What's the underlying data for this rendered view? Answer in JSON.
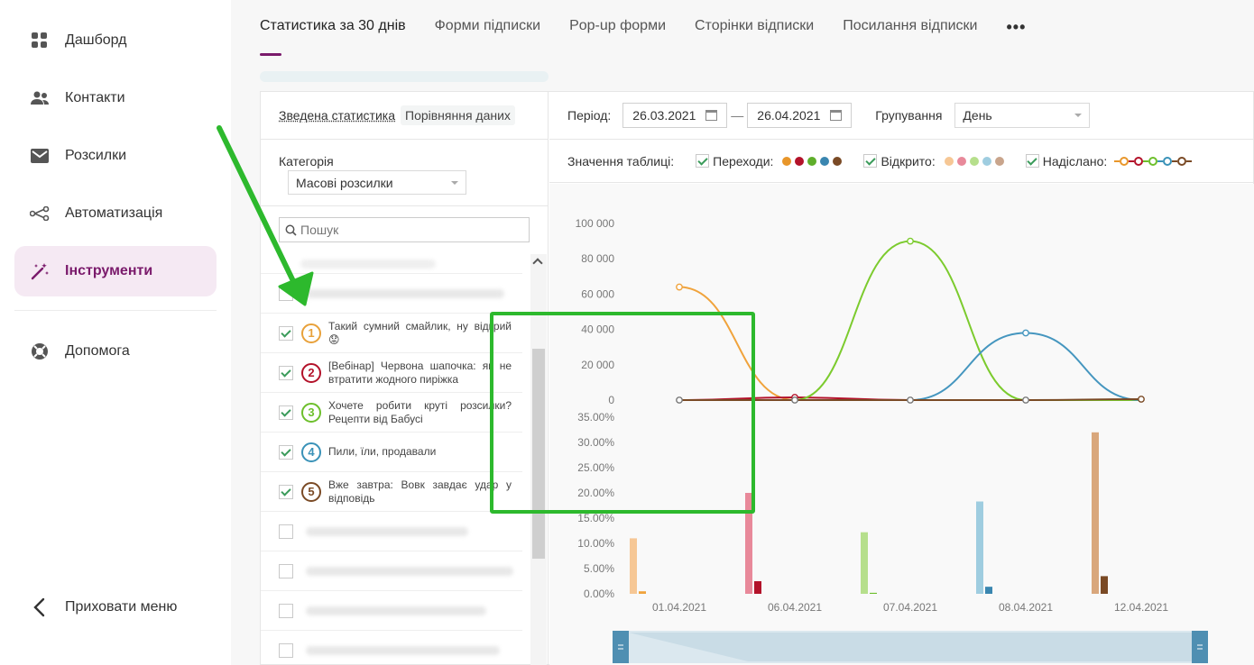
{
  "sidebar": {
    "items": [
      {
        "label": "Дашборд",
        "icon": "dashboard-icon"
      },
      {
        "label": "Контакти",
        "icon": "contacts-icon"
      },
      {
        "label": "Розсилки",
        "icon": "mail-icon"
      },
      {
        "label": "Автоматизація",
        "icon": "automation-icon"
      },
      {
        "label": "Інструменти",
        "icon": "magic-wand-icon",
        "active": true
      },
      {
        "label": "Допомога",
        "icon": "help-icon"
      }
    ],
    "collapse_label": "Приховати меню"
  },
  "tabs": [
    "Статистика за 30 днів",
    "Форми підписки",
    "Pop-up форми",
    "Сторінки відписки",
    "Посилання відписки"
  ],
  "tabs_more": "•••",
  "left": {
    "summary_link": "Зведена статистика",
    "compare_label": "Порівняння даних",
    "category_label": "Категорія",
    "category_value": "Масові розсилки",
    "search_placeholder": "Пошук",
    "campaigns": [
      {
        "n": "1",
        "text": "Такий сумний смайлик, ну відкрий 😟",
        "color": "#e8a13a"
      },
      {
        "n": "2",
        "text": "[Вебінар] Червона шапочка: як не втратити жодного пиріжка",
        "color": "#b3122a"
      },
      {
        "n": "3",
        "text": "Хочете робити круті розсилки? Рецепти від Бабусі",
        "color": "#6dbf2c"
      },
      {
        "n": "4",
        "text": "Пили, їли, продавали",
        "color": "#3a92b8"
      },
      {
        "n": "5",
        "text": "Вже завтра: Вовк завдає удар у відповідь",
        "color": "#7a4a25"
      }
    ]
  },
  "filters": {
    "period_label": "Період:",
    "date_from": "26.03.2021",
    "date_to": "26.04.2021",
    "group_label": "Групування",
    "group_value": "День"
  },
  "legend": {
    "label": "Значення таблиці:",
    "clicks": "Переходи:",
    "opened": "Відкрито:",
    "sent": "Надіслано:",
    "clicks_colors": [
      "#e8962a",
      "#b3122a",
      "#5fae2a",
      "#3a86b0",
      "#7a4a25"
    ],
    "opened_colors": [
      "#f6c795",
      "#e8899a",
      "#b6df8c",
      "#9fcde0",
      "#c9a58c"
    ],
    "sent_colors": [
      "#e8962a",
      "#b3122a",
      "#6dbf2c",
      "#3a92b8",
      "#7a4a25"
    ]
  },
  "chart_data": [
    {
      "type": "line",
      "x": [
        "01.04.2021",
        "06.04.2021",
        "07.04.2021",
        "08.04.2021",
        "12.04.2021"
      ],
      "ylim": [
        0,
        100000
      ],
      "yticks": [
        "100 000",
        "80 000",
        "60 000",
        "40 000",
        "20 000",
        "0"
      ],
      "colors": [
        "#f0a33c",
        "#b3122a",
        "#7ccb2e",
        "#4596bf",
        "#7a4a25"
      ],
      "series": [
        {
          "values": [
            64000,
            0,
            0,
            0,
            0
          ]
        },
        {
          "values": [
            0,
            1500,
            0,
            0,
            0
          ]
        },
        {
          "values": [
            0,
            0,
            90000,
            0,
            0
          ]
        },
        {
          "values": [
            0,
            0,
            0,
            38000,
            0
          ]
        },
        {
          "values": [
            0,
            0,
            0,
            0,
            500
          ]
        }
      ]
    },
    {
      "type": "bar",
      "categories": [
        "01.04.2021",
        "06.04.2021",
        "07.04.2021",
        "08.04.2021",
        "12.04.2021"
      ],
      "ylim": [
        0,
        35
      ],
      "yticks": [
        "35.00%",
        "30.00%",
        "25.00%",
        "20.00%",
        "15.00%",
        "10.00%",
        "5.00%",
        "0.00%"
      ],
      "series": [
        {
          "values": [
            11,
            0.5
          ],
          "colors": [
            "#f6c795",
            "#f0a33c"
          ]
        },
        {
          "values": [
            20,
            2.5
          ],
          "colors": [
            "#e8899a",
            "#b3122a"
          ]
        },
        {
          "values": [
            12.2,
            0.2
          ],
          "colors": [
            "#b6df8c",
            "#6dbf2c"
          ]
        },
        {
          "values": [
            18.3,
            1.4
          ],
          "colors": [
            "#9fcde0",
            "#3a86b0"
          ]
        },
        {
          "values": [
            32,
            3.5
          ],
          "colors": [
            "#d9a77c",
            "#7a4a25"
          ]
        }
      ]
    }
  ]
}
